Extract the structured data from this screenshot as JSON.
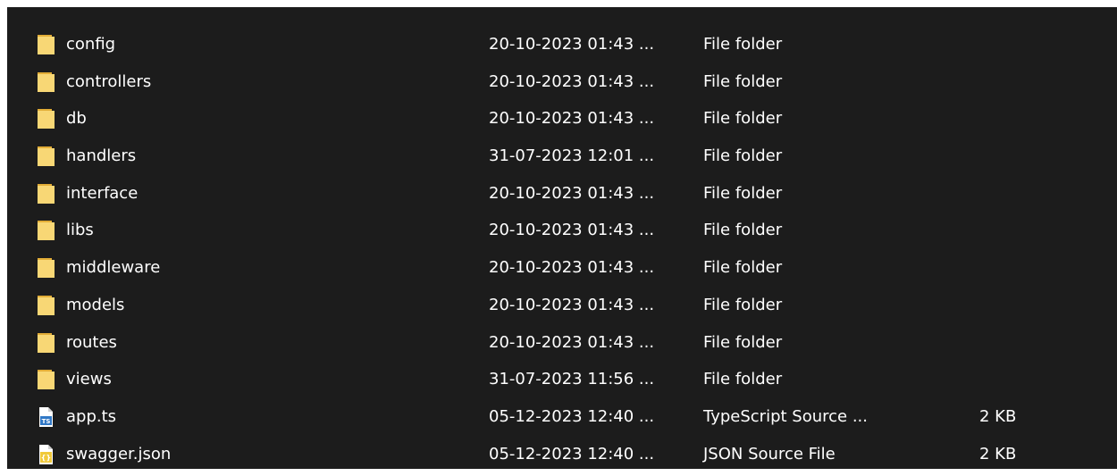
{
  "files": [
    {
      "name": "config",
      "date": "20-10-2023 01:43 ...",
      "type": "File folder",
      "size": "",
      "icon": "folder-icon"
    },
    {
      "name": "controllers",
      "date": "20-10-2023 01:43 ...",
      "type": "File folder",
      "size": "",
      "icon": "folder-icon"
    },
    {
      "name": "db",
      "date": "20-10-2023 01:43 ...",
      "type": "File folder",
      "size": "",
      "icon": "folder-icon"
    },
    {
      "name": "handlers",
      "date": "31-07-2023 12:01 ...",
      "type": "File folder",
      "size": "",
      "icon": "folder-icon"
    },
    {
      "name": "interface",
      "date": "20-10-2023 01:43 ...",
      "type": "File folder",
      "size": "",
      "icon": "folder-icon"
    },
    {
      "name": "libs",
      "date": "20-10-2023 01:43 ...",
      "type": "File folder",
      "size": "",
      "icon": "folder-icon"
    },
    {
      "name": "middleware",
      "date": "20-10-2023 01:43 ...",
      "type": "File folder",
      "size": "",
      "icon": "folder-icon"
    },
    {
      "name": "models",
      "date": "20-10-2023 01:43 ...",
      "type": "File folder",
      "size": "",
      "icon": "folder-icon"
    },
    {
      "name": "routes",
      "date": "20-10-2023 01:43 ...",
      "type": "File folder",
      "size": "",
      "icon": "folder-icon"
    },
    {
      "name": "views",
      "date": "31-07-2023 11:56 ...",
      "type": "File folder",
      "size": "",
      "icon": "folder-icon"
    },
    {
      "name": "app.ts",
      "date": "05-12-2023 12:40 ...",
      "type": "TypeScript Source ...",
      "size": "2 KB",
      "icon": "typescript-file-icon",
      "icon_text": "TS"
    },
    {
      "name": "swagger.json",
      "date": "05-12-2023 12:40 ...",
      "type": "JSON Source File",
      "size": "2 KB",
      "icon": "json-file-icon",
      "icon_text": "{}"
    }
  ],
  "colors": {
    "background": "#1c1c1c",
    "text": "#ffffff",
    "folder_body": "#f8d775",
    "folder_back": "#e2ad37",
    "ts_badge": "#3178c6",
    "json_badge": "#f0c93a"
  }
}
